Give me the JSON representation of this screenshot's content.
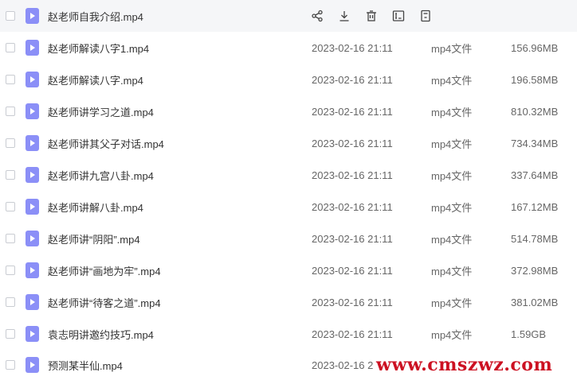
{
  "actions": [
    "share-icon",
    "download-icon",
    "delete-icon",
    "rename-icon",
    "more-icon"
  ],
  "files": [
    {
      "name": "赵老师自我介绍.mp4",
      "date": "",
      "type": "",
      "size": ""
    },
    {
      "name": "赵老师解读八字1.mp4",
      "date": "2023-02-16 21:11",
      "type": "mp4文件",
      "size": "156.96MB"
    },
    {
      "name": "赵老师解读八字.mp4",
      "date": "2023-02-16 21:11",
      "type": "mp4文件",
      "size": "196.58MB"
    },
    {
      "name": "赵老师讲学习之道.mp4",
      "date": "2023-02-16 21:11",
      "type": "mp4文件",
      "size": "810.32MB"
    },
    {
      "name": "赵老师讲其父子对话.mp4",
      "date": "2023-02-16 21:11",
      "type": "mp4文件",
      "size": "734.34MB"
    },
    {
      "name": "赵老师讲九宫八卦.mp4",
      "date": "2023-02-16 21:11",
      "type": "mp4文件",
      "size": "337.64MB"
    },
    {
      "name": "赵老师讲解八卦.mp4",
      "date": "2023-02-16 21:11",
      "type": "mp4文件",
      "size": "167.12MB"
    },
    {
      "name": "赵老师讲“阴阳”.mp4",
      "date": "2023-02-16 21:11",
      "type": "mp4文件",
      "size": "514.78MB"
    },
    {
      "name": "赵老师讲“画地为牢”.mp4",
      "date": "2023-02-16 21:11",
      "type": "mp4文件",
      "size": "372.98MB"
    },
    {
      "name": "赵老师讲“待客之道”.mp4",
      "date": "2023-02-16 21:11",
      "type": "mp4文件",
      "size": "381.02MB"
    },
    {
      "name": "袁志明讲邀约技巧.mp4",
      "date": "2023-02-16 21:11",
      "type": "mp4文件",
      "size": "1.59GB"
    },
    {
      "name": "预测某半仙.mp4",
      "date": "2023-02-16 2",
      "type": "",
      "size": ""
    }
  ],
  "watermark": "www.cmszwz.com"
}
